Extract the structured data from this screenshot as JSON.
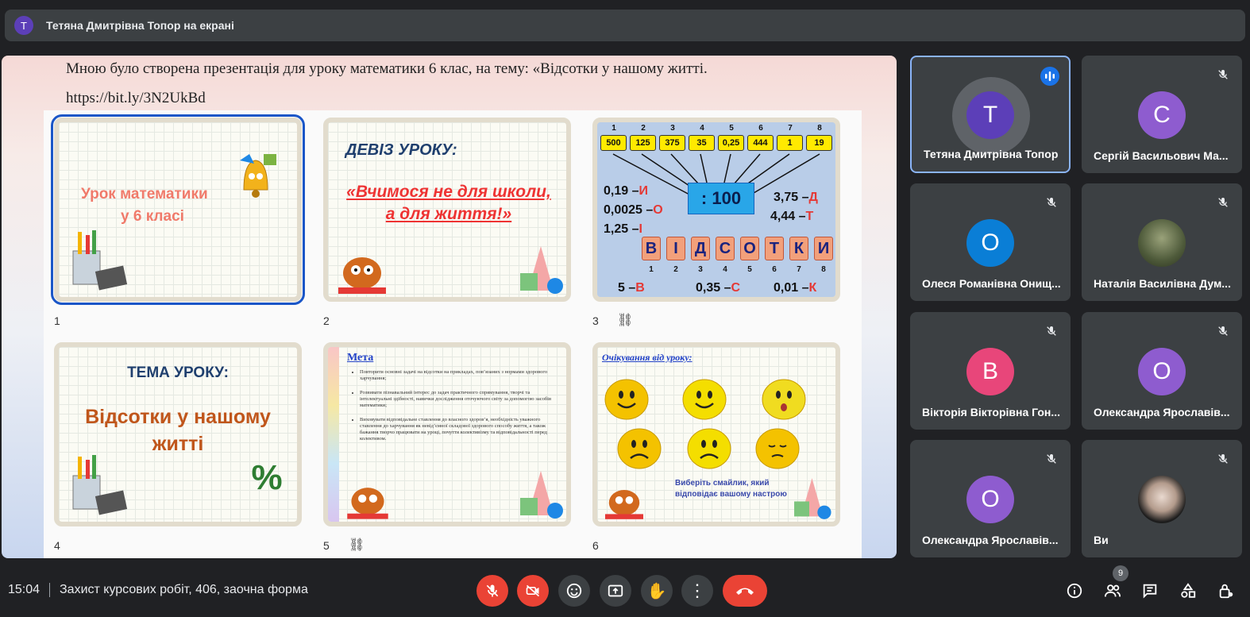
{
  "presenter_bar": {
    "avatar_letter": "Т",
    "title": "Тетяна Дмитрівна Топор на екрані"
  },
  "document": {
    "line1": "Мною було створена презентація для уроку математики 6 клас, на тему: «Відсотки у нашому житті.",
    "line2": "https://bit.ly/3N2UkBd"
  },
  "slides": [
    {
      "number": "1",
      "line1": "Урок математики",
      "line2": "у 6 класі"
    },
    {
      "number": "2",
      "heading": "ДЕВІЗ УРОКУ:",
      "line1": "«Вчимося не для школи,",
      "line2": "а для життя!»"
    },
    {
      "number": "3",
      "top_indices": [
        "1",
        "2",
        "3",
        "4",
        "5",
        "6",
        "7",
        "8"
      ],
      "top_values": [
        "500",
        "125",
        "375",
        "35",
        "0,25",
        "444",
        "1",
        "19"
      ],
      "divider": ": 100",
      "left_eqs": [
        {
          "v": "0,19 –",
          "l": "И"
        },
        {
          "v": "0,0025 –",
          "l": "О"
        },
        {
          "v": "1,25 –",
          "l": "І"
        }
      ],
      "right_eqs": [
        {
          "v": "3,75 –",
          "l": "Д"
        },
        {
          "v": "4,44 –",
          "l": "Т"
        }
      ],
      "letters": [
        "В",
        "І",
        "Д",
        "С",
        "О",
        "Т",
        "К",
        "И"
      ],
      "bottom_indices": [
        "1",
        "2",
        "3",
        "4",
        "5",
        "6",
        "7",
        "8"
      ],
      "bottom_eqs": [
        {
          "v": "5 –",
          "l": "В"
        },
        {
          "v": "0,35 –",
          "l": "С"
        },
        {
          "v": "0,01 –",
          "l": "К"
        }
      ]
    },
    {
      "number": "4",
      "heading": "ТЕМА УРОКУ:",
      "line1": "Відсотки у нашому",
      "line2": "житті"
    },
    {
      "number": "5",
      "heading": "Мета",
      "bullets": [
        "Повторити основні задачі на відсотки на прикладах, пов’язаних з нормами здорового харчування;",
        "Розвивати пізнавальний інтерес до задач практичного спрямування, творчі та інтелектуальні здібності, навички дослідження оточуючого світу за допомогою засобів математики;",
        "Виховувати відповідальне ставлення до власного здоров’я, необхідність уважного ставлення до харчування як невід’ємної складової здорового способу життя, а також бажання творчо працювати на уроці, почуття колективізму та відповідальності перед колективом."
      ]
    },
    {
      "number": "6",
      "heading": "Очікування від уроку:",
      "line1": "Виберіть смайлик, який",
      "line2": "відповідає вашому настрою"
    }
  ],
  "zoom": {
    "minus": "−",
    "plus": "+"
  },
  "participants": [
    {
      "name": "Тетяна Дмитрівна Топор",
      "letter": "Т",
      "color": "#5c3fb8",
      "speaking": true
    },
    {
      "name": "Сергій Васильович Ма...",
      "letter": "С",
      "color": "#8e5ccf"
    },
    {
      "name": "Олеся Романівна Онищ...",
      "letter": "О",
      "color": "#0a7ed6"
    },
    {
      "name": "Наталія Василівна Дум...",
      "letter": "",
      "photo": true
    },
    {
      "name": "Вікторія Вікторівна Гон...",
      "letter": "В",
      "color": "#e8467a"
    },
    {
      "name": "Олександра Ярославів...",
      "letter": "О",
      "color": "#8e5ccf"
    },
    {
      "name": "Олександра Ярославів...",
      "letter": "О",
      "color": "#8e5ccf"
    },
    {
      "name": "Ви",
      "letter": "",
      "photo": true
    }
  ],
  "bottom_bar": {
    "time": "15:04",
    "meeting": "Захист курсових робіт, 406, заочна форма",
    "participants_count": "9"
  }
}
